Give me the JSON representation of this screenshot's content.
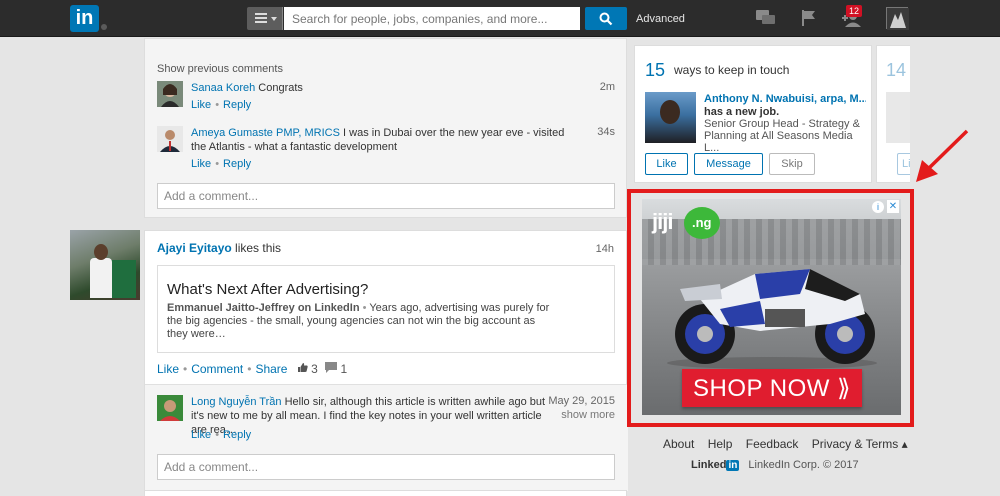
{
  "topbar": {
    "logo": "in",
    "search_placeholder": "Search for people, jobs, companies, and more...",
    "advanced": "Advanced",
    "notification_count": "12"
  },
  "card1": {
    "show_previous": "Show previous comments",
    "comments": [
      {
        "name": "Sanaa Koreh",
        "text": "Congrats",
        "time": "2m",
        "like": "Like",
        "reply": "Reply"
      },
      {
        "name": "Ameya Gumaste PMP, MRICS",
        "text": "I was in Dubai over the new year eve - visited the Atlantis - what a fantastic development",
        "time": "34s",
        "like": "Like",
        "reply": "Reply"
      }
    ],
    "add_comment_placeholder": "Add a comment..."
  },
  "card2": {
    "liker_name": "Ajayi Eyitayo",
    "liker_action": "likes this",
    "time": "14h",
    "article_title": "What's Next After Advertising?",
    "article_author": "Emmanuel Jaitto-Jeffrey on LinkedIn",
    "article_desc": "Years ago, advertising was purely for the big agencies - the small, young agencies can not win the big account as they were…",
    "like": "Like",
    "comment": "Comment",
    "share": "Share",
    "likes_count": "3",
    "comments_count": "1",
    "comment_item": {
      "name": "Long Nguyễn Trần",
      "text": "Hello sir, although this article is written awhile ago but it's new to me by all mean. I find the key notes in your well written article are rea…",
      "date": "May 29, 2015",
      "show_more": "show more",
      "like": "Like",
      "reply": "Reply"
    },
    "add_comment_placeholder": "Add a comment..."
  },
  "pymk": {
    "count": "15",
    "heading": "ways to keep in touch",
    "person_name": "Anthony N. Nwabuisi, arpa, M...",
    "new_job": "has a new job.",
    "job_desc": "Senior Group Head - Strategy & Planning at All Seasons Media L...",
    "like": "Like",
    "message": "Message",
    "skip": "Skip",
    "next_count": "14",
    "next_like": "Li"
  },
  "ad": {
    "brand": "jiji",
    "brand_suffix": ".ng",
    "cta": "SHOP NOW ⟫",
    "highlight_color": "#e31b1b"
  },
  "footer": {
    "links": [
      "About",
      "Help",
      "Feedback",
      "Privacy & Terms ▴"
    ],
    "brand": "Linked",
    "brand_in": "in",
    "copyright": "LinkedIn Corp. © 2017"
  }
}
